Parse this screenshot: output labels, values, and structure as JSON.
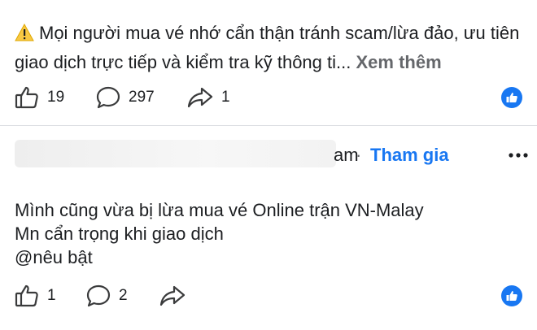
{
  "post": {
    "text": "Mọi người mua vé nhớ cẩn thận tránh scam/lừa đảo, ưu tiên giao dịch trực tiếp và kiểm tra kỹ thông ti...",
    "see_more": "Xem thêm",
    "likes": "19",
    "comments": "297",
    "shares": "1"
  },
  "comment": {
    "name_tail": "am",
    "separator": "·",
    "join_label": "Tham gia",
    "lines": [
      "Mình cũng vừa bị lừa mua vé Online trận VN-Malay",
      "Mn cẩn trọng khi giao dịch",
      "@nêu bật"
    ],
    "likes": "1",
    "replies": "2"
  },
  "colors": {
    "accent": "#1877f2",
    "muted": "#65676b",
    "divider": "#dadde1"
  },
  "icons": [
    "warning-icon",
    "thumbs-up-icon",
    "comment-bubble-icon",
    "share-arrow-icon",
    "like-badge-icon",
    "more-dots-icon"
  ]
}
